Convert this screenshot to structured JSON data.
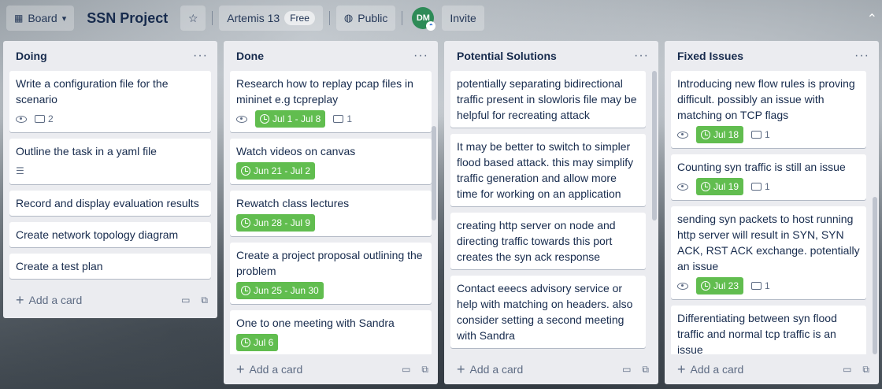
{
  "header": {
    "board_button": "Board",
    "board_title": "SSN Project",
    "workspace": "Artemis 13",
    "workspace_badge": "Free",
    "visibility": "Public",
    "avatar_initials": "DM",
    "invite": "Invite"
  },
  "lists": [
    {
      "title": "Doing",
      "add_card": "Add a card",
      "cards": [
        {
          "title": "Write a configuration file for the scenario",
          "comments": "2"
        },
        {
          "title": "Outline the task in a yaml file"
        },
        {
          "title": "Record and display evaluation results"
        },
        {
          "title": "Create network topology diagram"
        },
        {
          "title": "Create a test plan"
        }
      ]
    },
    {
      "title": "Done",
      "add_card": "Add a card",
      "cards": [
        {
          "title": "Research how to replay pcap files in mininet e.g tcpreplay",
          "date": "Jul 1 - Jul 8",
          "comments": "1"
        },
        {
          "title": "Watch videos on canvas",
          "date": "Jun 21 - Jul 2"
        },
        {
          "title": "Rewatch class lectures",
          "date": "Jun 28 - Jul 9"
        },
        {
          "title": "Create a project proposal outlining the problem",
          "date": "Jun 25 - Jun 30"
        },
        {
          "title": "One to one meeting with Sandra",
          "date": "Jul 6"
        }
      ]
    },
    {
      "title": "Potential Solutions",
      "add_card": "Add a card",
      "cards": [
        {
          "title": "potentially separating bidirectional traffic present in slowloris file may be helpful for recreating attack"
        },
        {
          "title": "It may be better to switch to simpler flood based attack. this may simplify traffic generation and allow more time for working on an application"
        },
        {
          "title": "creating http server on node and directing traffic towards this port creates the syn ack response"
        },
        {
          "title": "Contact eeecs advisory service or help with matching on headers. also consider setting a second meeting with Sandra"
        }
      ]
    },
    {
      "title": "Fixed Issues",
      "add_card": "Add a card",
      "cards": [
        {
          "title": "Introducing new flow rules is proving difficult. possibly an issue with matching on TCP flags",
          "date": "Jul 18",
          "comments": "1"
        },
        {
          "title": "Counting syn traffic is still an issue",
          "date": "Jul 19",
          "comments": "1"
        },
        {
          "title": "sending syn packets to host running http server will result in SYN, SYN ACK, RST ACK exchange. potentially an issue",
          "date": "Jul 23",
          "comments": "1"
        },
        {
          "title": "Differentiating between syn flood traffic and normal tcp traffic is an issue"
        }
      ]
    }
  ],
  "colors": {
    "date_badge": "#61bd4f",
    "list_bg": "#ebecf0",
    "avatar": "#2e8b57"
  }
}
